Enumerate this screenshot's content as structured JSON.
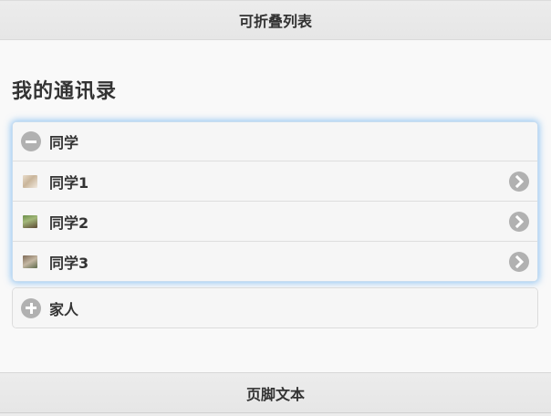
{
  "header": {
    "title": "可折叠列表"
  },
  "page": {
    "title": "我的通讯录"
  },
  "groups": [
    {
      "label": "同学",
      "state": "expanded",
      "icon": "minus-circle-icon",
      "items": [
        {
          "label": "同学1",
          "thumbnail": "avatar-thumbnail",
          "icon": "chevron-right-icon"
        },
        {
          "label": "同学2",
          "thumbnail": "avatar-thumbnail",
          "icon": "chevron-right-icon"
        },
        {
          "label": "同学3",
          "thumbnail": "avatar-thumbnail",
          "icon": "chevron-right-icon"
        }
      ]
    },
    {
      "label": "家人",
      "state": "collapsed",
      "icon": "plus-circle-icon",
      "items": []
    }
  ],
  "footer": {
    "text": "页脚文本"
  },
  "colors": {
    "bar_background": "#e9e9e9",
    "icon_gray": "#b1b1b1",
    "focus_glow": "#3898ec",
    "text": "#333333"
  }
}
